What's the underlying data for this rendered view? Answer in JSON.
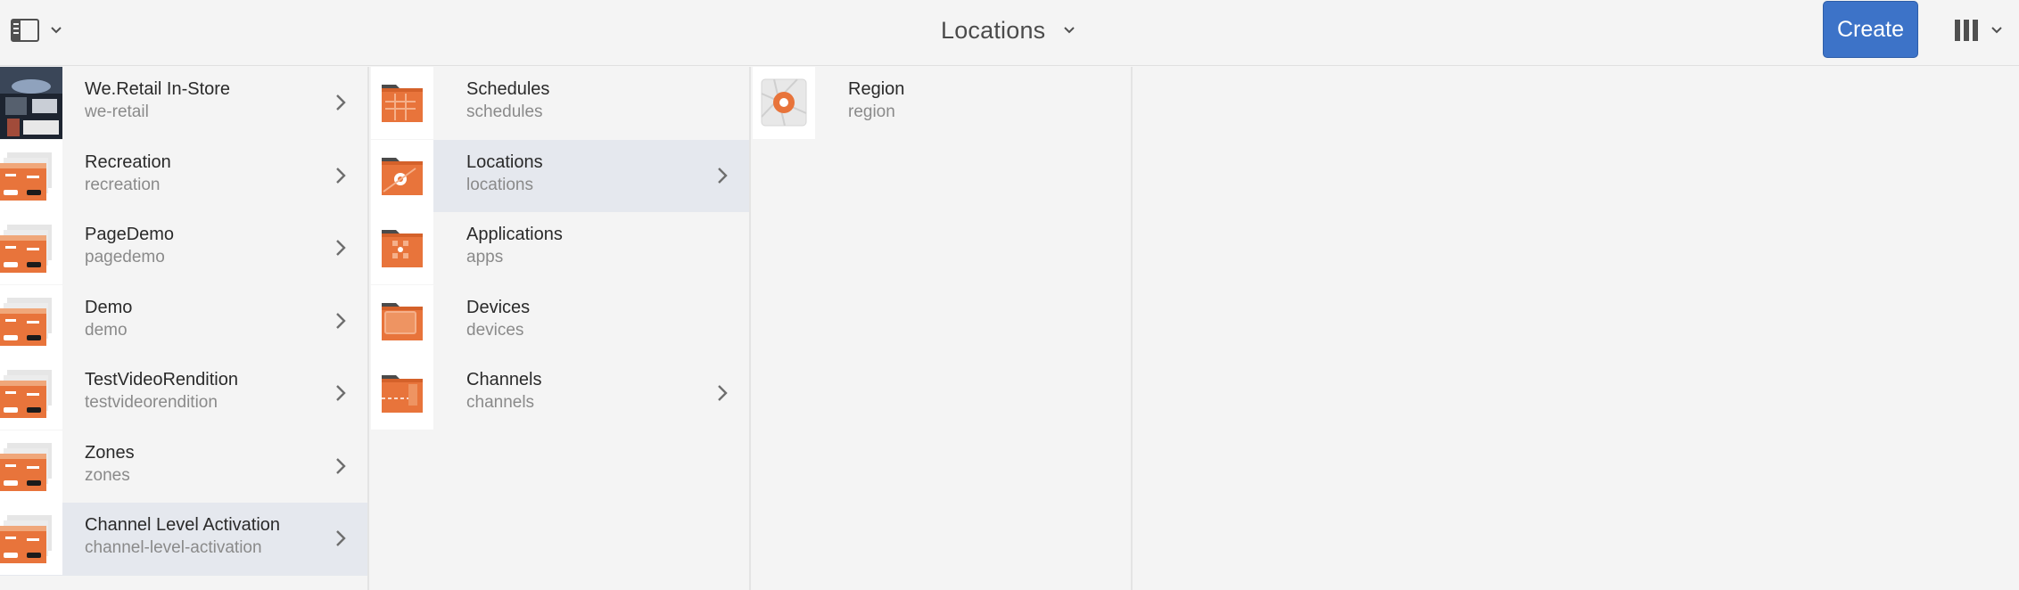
{
  "header": {
    "title": "Locations",
    "create_label": "Create"
  },
  "column1": {
    "items": [
      {
        "label": "We.Retail In-Store",
        "sub": "we-retail",
        "has_children": true,
        "active": false
      },
      {
        "label": "Recreation",
        "sub": "recreation",
        "has_children": true,
        "active": false
      },
      {
        "label": "PageDemo",
        "sub": "pagedemo",
        "has_children": true,
        "active": false
      },
      {
        "label": "Demo",
        "sub": "demo",
        "has_children": true,
        "active": false
      },
      {
        "label": "TestVideoRendition",
        "sub": "testvideorendition",
        "has_children": true,
        "active": false
      },
      {
        "label": "Zones",
        "sub": "zones",
        "has_children": true,
        "active": false
      },
      {
        "label": "Channel Level Activation",
        "sub": "channel-level-activation",
        "has_children": true,
        "active": true
      }
    ]
  },
  "column2": {
    "items": [
      {
        "label": "Schedules",
        "sub": "schedules",
        "has_children": false,
        "active": false,
        "icon": "schedules-folder-icon"
      },
      {
        "label": "Locations",
        "sub": "locations",
        "has_children": true,
        "active": true,
        "icon": "locations-folder-icon"
      },
      {
        "label": "Applications",
        "sub": "apps",
        "has_children": false,
        "active": false,
        "icon": "applications-folder-icon"
      },
      {
        "label": "Devices",
        "sub": "devices",
        "has_children": false,
        "active": false,
        "icon": "devices-folder-icon"
      },
      {
        "label": "Channels",
        "sub": "channels",
        "has_children": true,
        "active": false,
        "icon": "channels-folder-icon"
      }
    ]
  },
  "column3": {
    "items": [
      {
        "label": "Region",
        "sub": "region",
        "has_children": false,
        "active": false,
        "icon": "location-pin-icon"
      }
    ]
  },
  "colors": {
    "accent": "#3d73c8",
    "folder_orange": "#e8743b",
    "active_row": "#e5e8ee"
  }
}
